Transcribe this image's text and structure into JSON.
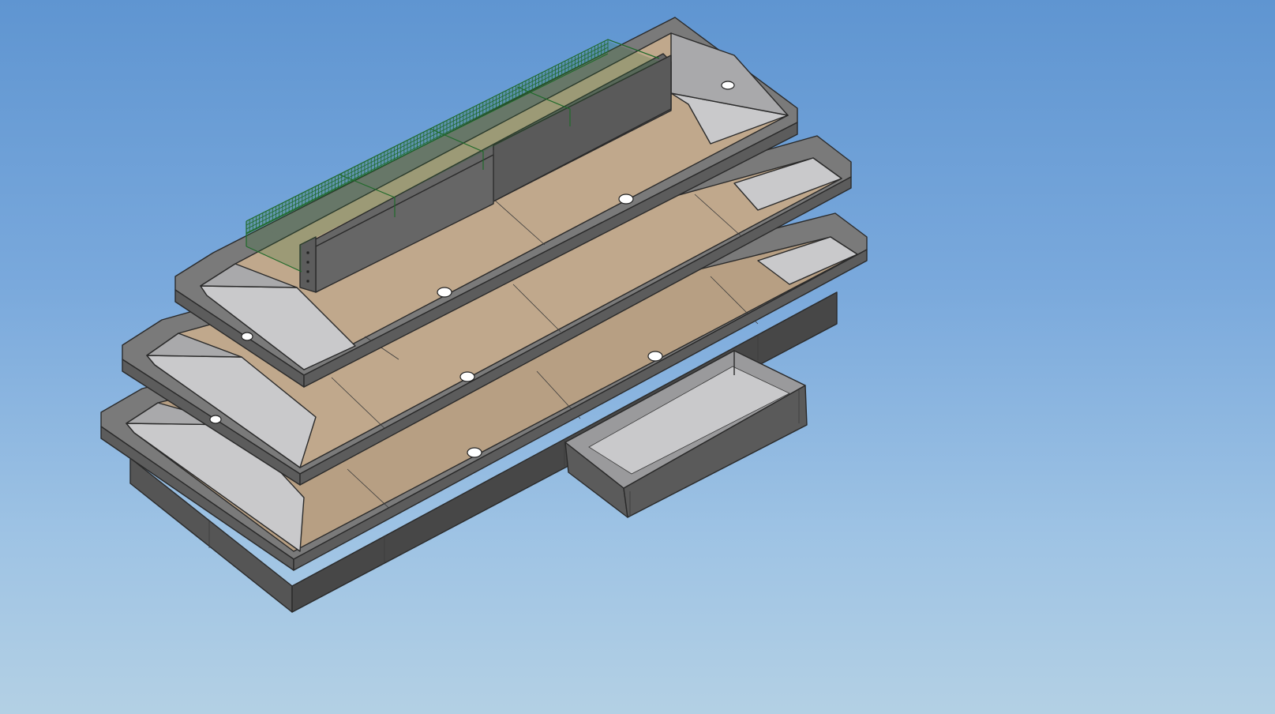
{
  "viewport": {
    "background_top": "#5f95d1",
    "background_bottom": "#b3d0e4"
  },
  "model": {
    "description_label": "",
    "tiers": 3,
    "basket_color": "#2f6f35",
    "tray_color": "#b79f83",
    "frame_color": "#5c5c5c"
  }
}
